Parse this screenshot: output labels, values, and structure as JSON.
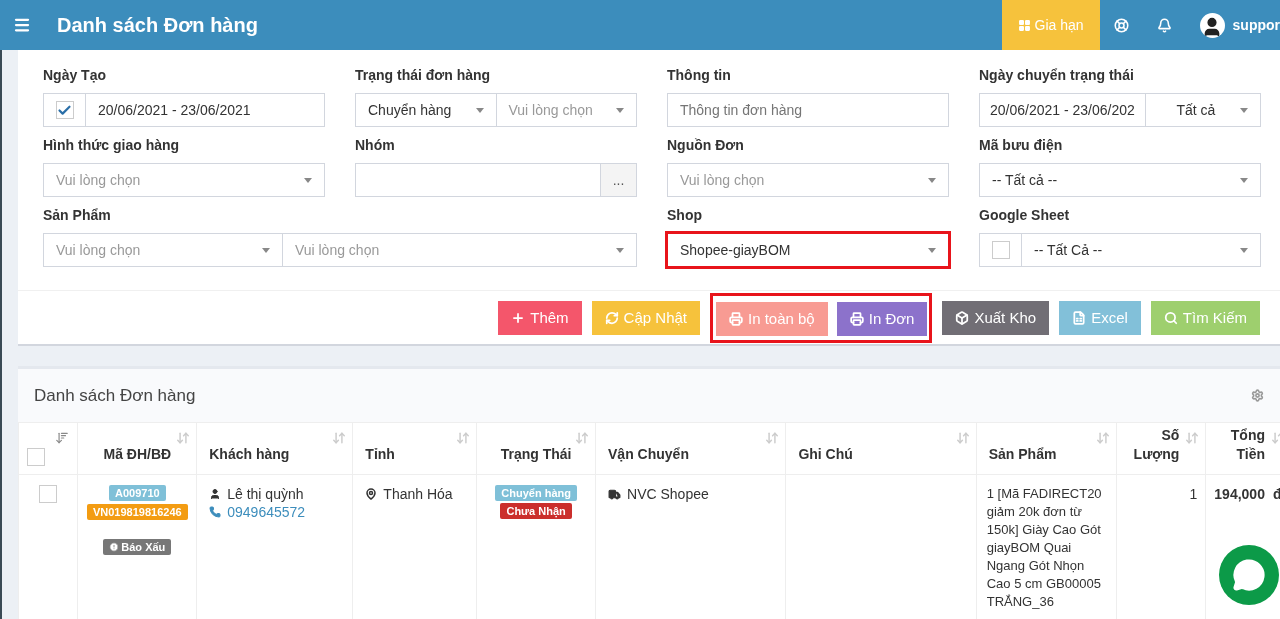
{
  "topbar": {
    "title": "Danh sách Đơn hàng",
    "renew_button": "Gia hạn",
    "user": "suppor"
  },
  "filters": [
    {
      "label": "Ngày Tạo",
      "kind": "check_date",
      "checked": true,
      "value": "20/06/2021 - 23/06/2021"
    },
    {
      "label": "Trạng thái đơn hàng",
      "kind": "select_pair",
      "selects": [
        {
          "value": "Chuyển hàng"
        },
        {
          "placeholder": "Vui lòng chọn"
        }
      ]
    },
    {
      "label": "Thông tin",
      "kind": "text",
      "placeholder": "Thông tin đơn hàng"
    },
    {
      "label": "Ngày chuyển trạng thái",
      "kind": "date_select",
      "value": "20/06/2021 - 23/06/202",
      "select": "Tất cả"
    },
    {
      "label": "Hình thức giao hàng",
      "kind": "select",
      "placeholder": "Vui lòng chọn"
    },
    {
      "label": "Nhóm",
      "kind": "input_button",
      "button": "..."
    },
    {
      "label": "Nguồn Đơn",
      "kind": "select",
      "placeholder": "Vui lòng chọn"
    },
    {
      "label": "Mã bưu điện",
      "kind": "select",
      "value": "-- Tất cả --"
    },
    {
      "label": "Sản Phẩm",
      "kind": "select_pair",
      "wide": true,
      "selects": [
        {
          "placeholder": "Vui lòng chọn"
        },
        {
          "placeholder": "Vui lòng chọn"
        }
      ]
    },
    {
      "label": "Shop",
      "kind": "select",
      "value": "Shopee-giayBOM",
      "highlighted": true
    },
    {
      "label": "Google Sheet",
      "kind": "check_select",
      "checked": false,
      "value": "-- Tất Cả --"
    }
  ],
  "buttons": [
    {
      "label": "Thêm",
      "kind": "add",
      "color": "#f4566b",
      "highlighted": false
    },
    {
      "label": "Cập Nhật",
      "kind": "update",
      "color": "#f6c23c",
      "highlighted": false
    },
    {
      "label": "In toàn bộ",
      "kind": "print",
      "color": "#f89b93",
      "highlighted": true
    },
    {
      "label": "In Đơn",
      "kind": "print",
      "color": "#8c72cb",
      "highlighted": true
    },
    {
      "label": "Xuất Kho",
      "kind": "export",
      "color": "#716e75",
      "highlighted": false
    },
    {
      "label": "Excel",
      "kind": "excel",
      "color": "#82c0d9",
      "highlighted": false
    },
    {
      "label": "Tìm Kiếm",
      "kind": "search",
      "color": "#9ecf6e",
      "highlighted": false
    }
  ],
  "orders": {
    "title": "Danh sách Đơn hàng",
    "select_all_checked": false,
    "columns": [
      "Mã ĐH/BĐ",
      "Khách hàng",
      "Tỉnh",
      "Trạng Thái",
      "Vận Chuyển",
      "Ghi Chú",
      "Sản Phẩm",
      "Số Lượng",
      "Tổng Tiền"
    ],
    "rows": [
      {
        "checked": false,
        "order_code": "A009710",
        "tracking_code": "VN019819816246",
        "flag": "Báo Xấu",
        "customer": "Lê thị quỳnh",
        "phone": "0949645572",
        "province": "Thanh Hóa",
        "statuses": [
          {
            "label": "Chuyển hàng",
            "color": "#7fc0d8"
          },
          {
            "label": "Chưa Nhận",
            "color": "#cb2f2c"
          }
        ],
        "carrier": "NVC Shopee",
        "product": "1 [Mã FADIRECT20 giảm 20k đơn từ 150k] Giày Cao Gót giayBOM Quai Ngang Gót Nhọn Cao 5 cm GB00005 TRẮNG_36",
        "quantity": "1",
        "total": "194,000",
        "currency": "đ"
      }
    ]
  }
}
